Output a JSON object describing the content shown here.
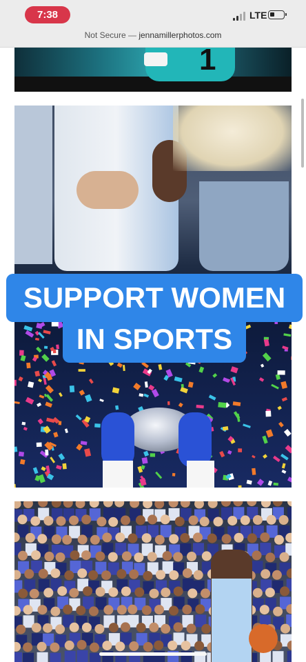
{
  "status_bar": {
    "time": "7:38",
    "carrier": "LTE",
    "signal_bars": 2,
    "battery_level": 0.2
  },
  "browser": {
    "security_label": "Not Secure",
    "separator": "—",
    "host": "jennamillerphotos.com"
  },
  "photos": [
    {
      "name": "teal-jersey-player",
      "jersey_number": "1"
    },
    {
      "name": "trophy-confetti-celebration"
    },
    {
      "name": "crowd-basketball-player"
    }
  ],
  "caption": {
    "line1": "SUPPORT WOMEN",
    "line2": "IN SPORTS",
    "color": "#2f86e8"
  }
}
